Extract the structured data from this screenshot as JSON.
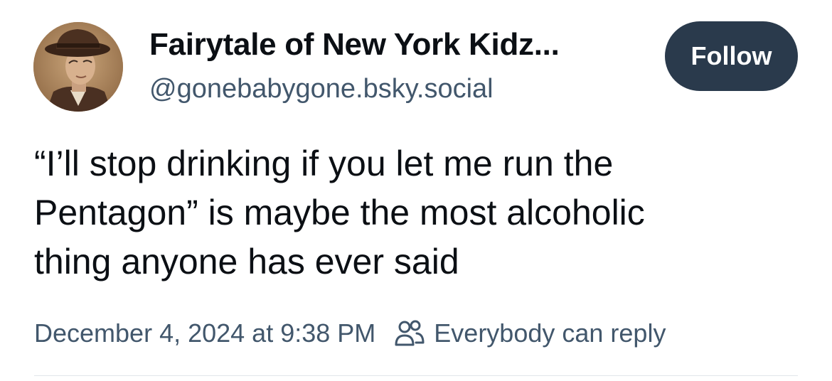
{
  "author": {
    "display_name": "Fairytale of New York Kidz...",
    "handle": "@gonebabygone.bsky.social"
  },
  "follow_button": {
    "label": "Follow"
  },
  "post": {
    "lines": [
      "“I’ll stop drinking if you let me run the",
      "Pentagon” is maybe the most alcoholic",
      "thing anyone has ever said"
    ]
  },
  "meta": {
    "timestamp": "December 4, 2024 at 9:38 PM",
    "reply_setting": "Everybody can reply",
    "reply_icon": "people-icon"
  },
  "colors": {
    "text_primary": "#0b0f14",
    "text_secondary": "#42576c",
    "follow_bg": "#2a3a4c",
    "divider": "#e1e5ea"
  }
}
